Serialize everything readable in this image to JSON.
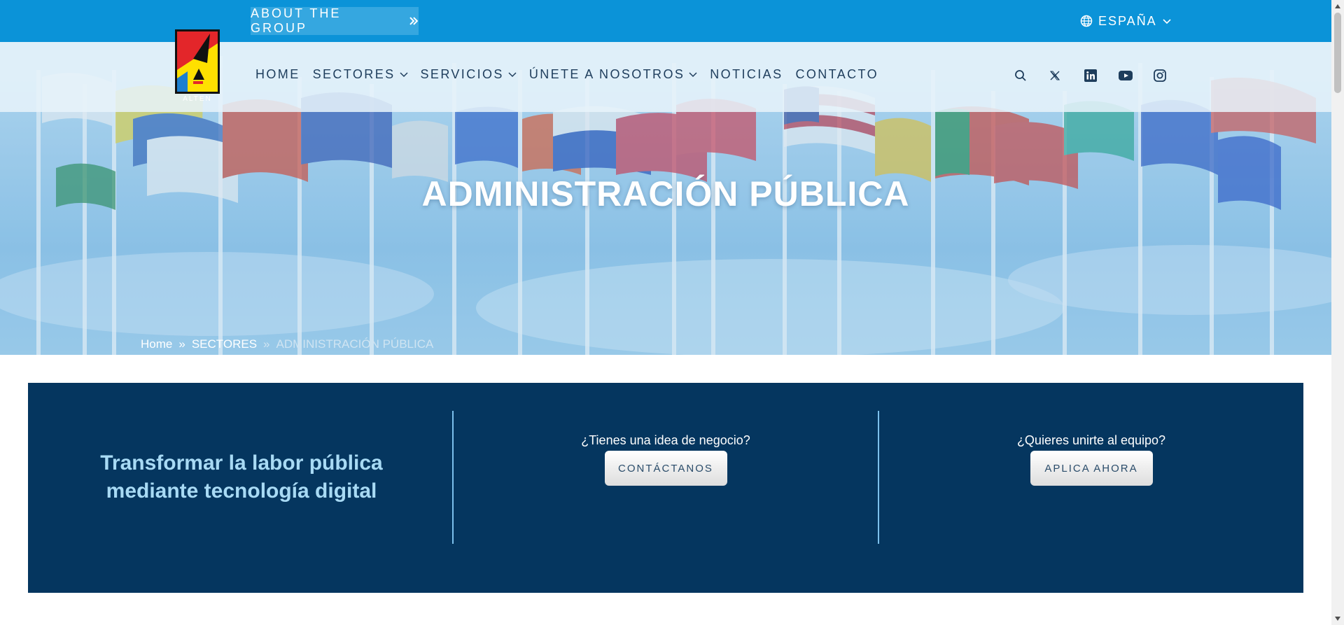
{
  "top_bar": {
    "about_label": "ABOUT THE GROUP",
    "language_label": "ESPAÑA"
  },
  "logo": {
    "text": "ALTEN",
    "colors": {
      "red": "#e3262a",
      "yellow": "#ffe000",
      "black": "#111111",
      "blue": "#1c7fd0"
    }
  },
  "nav": {
    "items": [
      {
        "label": "HOME",
        "has_dropdown": false
      },
      {
        "label": "SECTORES",
        "has_dropdown": true
      },
      {
        "label": "SERVICIOS",
        "has_dropdown": true
      },
      {
        "label": "ÚNETE A NOSOTROS",
        "has_dropdown": true
      },
      {
        "label": "NOTICIAS",
        "has_dropdown": false
      },
      {
        "label": "CONTACTO",
        "has_dropdown": false
      }
    ],
    "icons": [
      "search-icon",
      "x-twitter-icon",
      "linkedin-icon",
      "youtube-icon",
      "instagram-icon"
    ]
  },
  "hero": {
    "title": "ADMINISTRACIÓN PÚBLICA",
    "breadcrumb": {
      "home": "Home",
      "separator": "»",
      "section": "SECTORES",
      "current": "ADMINISTRACIÓN PÚBLICA"
    }
  },
  "band": {
    "tagline": "Transformar la labor pública mediante tecnología digital",
    "cta_business": {
      "question": "¿Tienes una idea de negocio?",
      "button": "CONTÁCTANOS"
    },
    "cta_join": {
      "question": "¿Quieres unirte al equipo?",
      "button": "APLICA AHORA"
    }
  },
  "colors": {
    "top_bar": "#0b93d8",
    "band": "#05365f",
    "band_title": "#a8daf4",
    "nav_text": "#1e3d5c",
    "divider": "#7cc0ec"
  }
}
